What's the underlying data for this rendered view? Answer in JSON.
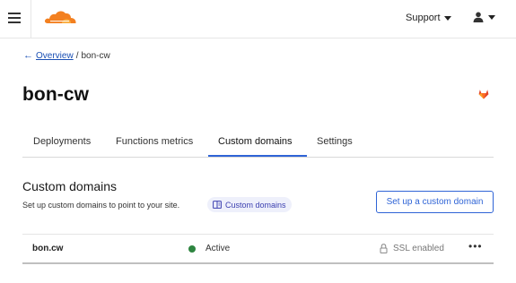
{
  "header": {
    "logo_name": "cloudflare-logo",
    "brand_color": "#f38020",
    "support_label": "Support"
  },
  "breadcrumb": {
    "back_label": "Overview",
    "separator": "/",
    "current": "bon-cw"
  },
  "page": {
    "title": "bon-cw",
    "repo_icon": "gitlab-icon"
  },
  "tabs": [
    {
      "label": "Deployments",
      "active": false
    },
    {
      "label": "Functions metrics",
      "active": false
    },
    {
      "label": "Custom domains",
      "active": true
    },
    {
      "label": "Settings",
      "active": false
    }
  ],
  "section": {
    "title": "Custom domains",
    "description": "Set up custom domains to point to your site.",
    "doc_link_label": "Custom domains",
    "setup_button_label": "Set up a custom domain"
  },
  "domains": [
    {
      "name": "bon.cw",
      "status": "Active",
      "status_color": "#2e8540",
      "ssl": "SSL enabled"
    }
  ],
  "colors": {
    "accent": "#2f64d6",
    "link": "#1a4fb4",
    "pill_bg": "#eef0fb"
  }
}
